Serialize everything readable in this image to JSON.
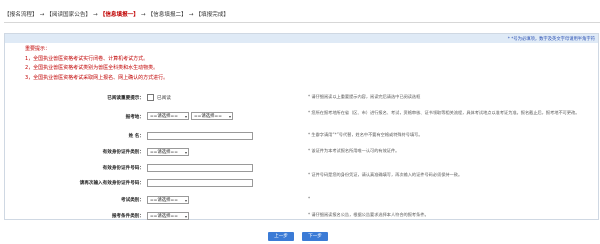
{
  "steps": [
    {
      "label": "【报名流程】",
      "active": false
    },
    {
      "label": "【阅读国家公告】",
      "active": false
    },
    {
      "label": "【信息填报一】",
      "active": true
    },
    {
      "label": "【信息填报二】",
      "active": false
    },
    {
      "label": "【填报完成】",
      "active": false
    }
  ],
  "step_arrow": "→",
  "required_note": "* *号为必填项，数字及英文字母请用半角字符",
  "notice": {
    "title": "重要提示：",
    "items": [
      "1，全国执业兽医资格考试实行闭卷、计算机考试方式。",
      "2，全国执业兽医资格考试类别为兽医全科类和水生动物类。",
      "3，全国执业兽医资格考试采取网上报名、网上确认的方式进行。"
    ]
  },
  "form": {
    "read_notice": {
      "label": "已阅读重要提示：",
      "option": "已阅读",
      "hint": "* 请仔细阅读以上重要提示内容，阅读完后请选中已阅读选框"
    },
    "exam_location": {
      "label": "报考地：",
      "value1": "==请选择==",
      "value2": "==请选择==",
      "hint": "* 您所在报考地所在省（区、市）进行报名、考试，资格审核、证书领取等相关流程，具体考试地点以准考证为准。报名截止后，报考地不可更改。"
    },
    "name": {
      "label": "姓 名：",
      "value": "",
      "hint": "* 生僻字请用“*”号代替，姓名中不要有空格或特殊符号填写。"
    },
    "id_type": {
      "label": "有效身份证件类别：",
      "value": "==请选择==",
      "hint": "* 该证件为本考试报名所用唯一认可的有效证件。"
    },
    "id_number": {
      "label": "有效身份证件号码：",
      "value": ""
    },
    "id_number_confirm": {
      "label": "请再次输入有效身份证件号码：",
      "value": "",
      "hint": "* 证件号码是您的身份凭证，请认真准确填写，再次输入的证件号码必须保持一致。"
    },
    "exam_category": {
      "label": "考试类别：",
      "value": "==请选择==",
      "hint": "*"
    },
    "exam_condition": {
      "label": "报考条件类别：",
      "value": "==请选择==",
      "hint": "* 请仔细阅读报名公告，根据公告要求选择本人符合的报考条件。"
    }
  },
  "buttons": {
    "prev": "上一步",
    "next": "下一步"
  }
}
